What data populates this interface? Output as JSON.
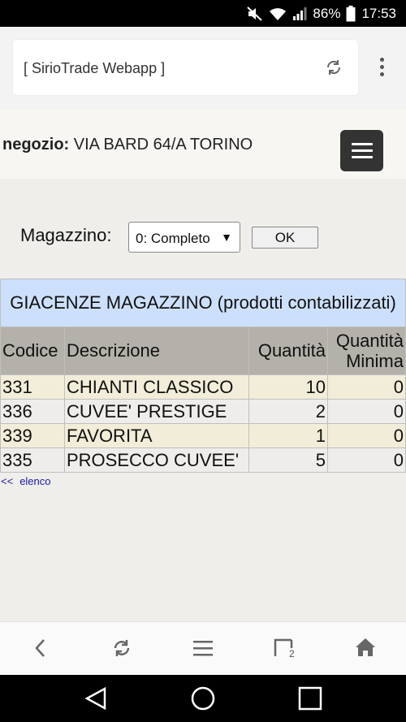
{
  "status": {
    "battery_percent": "86%",
    "time": "17:53"
  },
  "browser": {
    "url_label": "[ SirioTrade Webapp ]"
  },
  "store": {
    "label": "negozio:",
    "name": "VIA BARD 64/A TORINO"
  },
  "filter": {
    "label": "Magazzino:",
    "selected": "0: Completo",
    "ok_label": "OK"
  },
  "table": {
    "caption": "GIACENZE MAGAZZINO (prodotti contabilizzati)",
    "headers": [
      "Codice",
      "Descrizione",
      "Quantità",
      "Quantità Minima"
    ],
    "rows": [
      {
        "codice": "331",
        "descrizione": "CHIANTI CLASSICO",
        "quantita": "10",
        "minima": "0"
      },
      {
        "codice": "336",
        "descrizione": "CUVEE' PRESTIGE",
        "quantita": "2",
        "minima": "0"
      },
      {
        "codice": "339",
        "descrizione": "FAVORITA",
        "quantita": "1",
        "minima": "0"
      },
      {
        "codice": "335",
        "descrizione": "PROSECCO CUVEE'",
        "quantita": "5",
        "minima": "0"
      }
    ]
  },
  "back_link": {
    "arrows": "<<",
    "label": "elenco"
  },
  "navbar": {
    "tabs_count": "2"
  },
  "icons": {
    "status": [
      "mute-icon",
      "wifi-icon",
      "signal-icon",
      "battery-icon"
    ],
    "browser": [
      "reload-icon",
      "overflow-menu-icon"
    ],
    "navbar": [
      "back-icon",
      "refresh-icon",
      "menu-icon",
      "tabs-icon",
      "home-icon"
    ],
    "system": [
      "system-back-icon",
      "system-home-icon",
      "system-recents-icon"
    ]
  }
}
